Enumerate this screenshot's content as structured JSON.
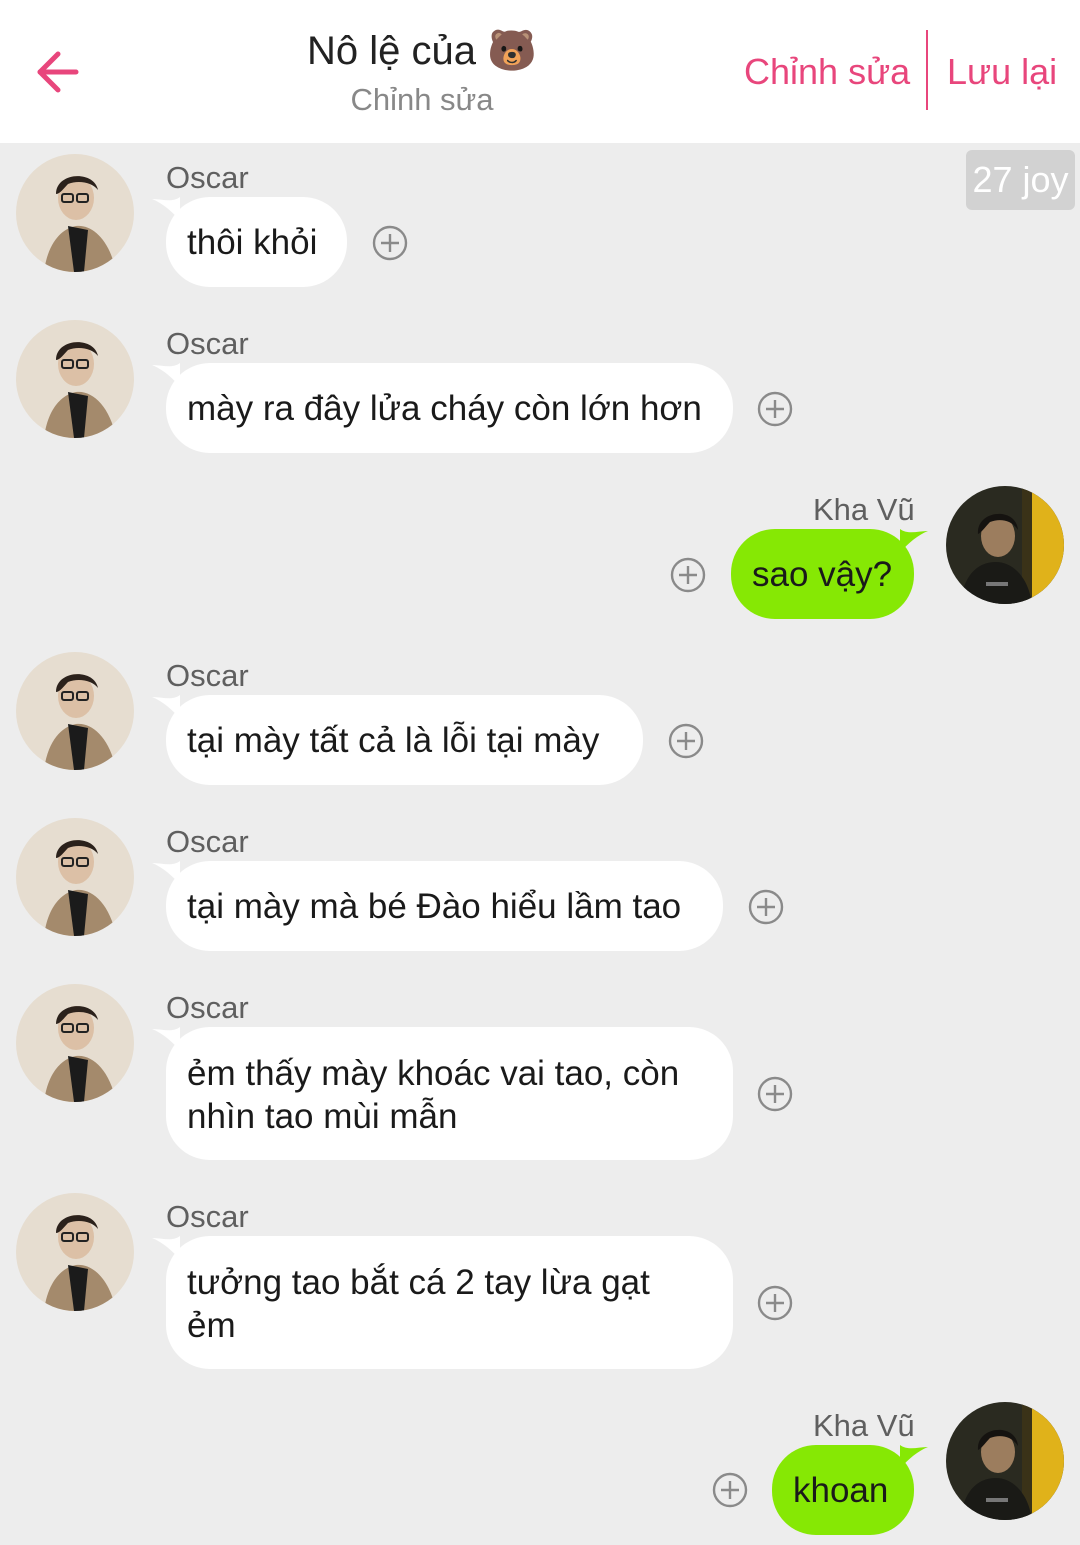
{
  "header": {
    "title": "Nô lệ của 🐻",
    "subtitle": "Chỉnh sửa",
    "edit_label": "Chỉnh sửa",
    "save_label": "Lưu lại",
    "accent_color": "#e8467c"
  },
  "date_badge": "27 joy",
  "messages": [
    {
      "sender": "Oscar",
      "text": "thôi khỏi",
      "side": "incoming"
    },
    {
      "sender": "Oscar",
      "text": "mày ra đây lửa cháy còn lớn hơn",
      "side": "incoming"
    },
    {
      "sender": "Kha Vũ",
      "text": "sao vậy?",
      "side": "outgoing"
    },
    {
      "sender": "Oscar",
      "text": "tại mày tất cả là lỗi tại mày",
      "side": "incoming"
    },
    {
      "sender": "Oscar",
      "text": "tại mày mà bé Đào hiểu lầm tao",
      "side": "incoming"
    },
    {
      "sender": "Oscar",
      "text": "ẻm thấy mày khoác vai tao, còn nhìn tao mùi mẫn",
      "side": "incoming"
    },
    {
      "sender": "Oscar",
      "text": "tưởng tao bắt cá 2 tay lừa gạt ẻm",
      "side": "incoming"
    },
    {
      "sender": "Kha Vũ",
      "text": "khoan",
      "side": "outgoing"
    }
  ],
  "colors": {
    "background": "#ededed",
    "incoming_bubble": "#ffffff",
    "outgoing_bubble": "#86e804"
  },
  "icons": {
    "back": "arrow-left-icon",
    "add": "plus-circle-icon"
  }
}
